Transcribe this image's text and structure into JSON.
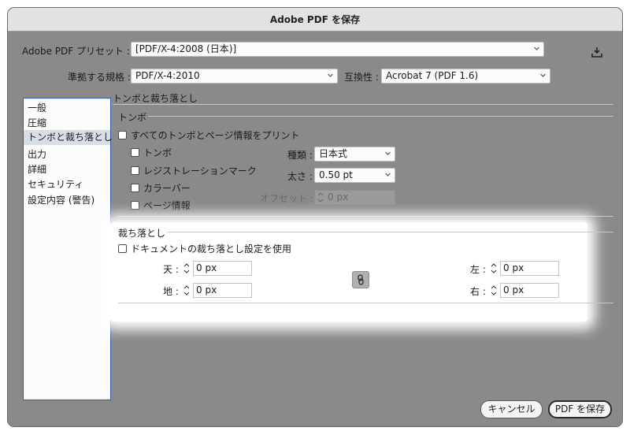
{
  "window": {
    "title": "Adobe PDF を保存"
  },
  "preset": {
    "label": "Adobe PDF プリセット :",
    "value": "[PDF/X-4:2008 (日本)]"
  },
  "standard": {
    "label": "準拠する規格 :",
    "value": "PDF/X-4:2010"
  },
  "compat": {
    "label": "互換性 :",
    "value": "Acrobat 7 (PDF 1.6)"
  },
  "sidebar": {
    "items": [
      {
        "label": "一般"
      },
      {
        "label": "圧縮"
      },
      {
        "label": "トンボと裁ち落とし"
      },
      {
        "label": "出力"
      },
      {
        "label": "詳細"
      },
      {
        "label": "セキュリティ"
      },
      {
        "label": "設定内容 (警告)"
      }
    ],
    "selected_index": 2
  },
  "section": {
    "title": "トンボと裁ち落とし"
  },
  "marks": {
    "group_title": "トンボ",
    "all_marks": "すべてのトンボとページ情報をプリント",
    "trim_marks": "トンボ",
    "registration_marks": "レジストレーションマーク",
    "color_bars": "カラーバー",
    "page_info": "ページ情報",
    "type_label": "種類 :",
    "type_value": "日本式",
    "weight_label": "太さ :",
    "weight_value": "0.50 pt",
    "offset_label": "オフセット :",
    "offset_value": "0 px"
  },
  "bleed": {
    "group_title": "裁ち落とし",
    "use_document": "ドキュメントの裁ち落とし設定を使用",
    "top_label": "天 :",
    "top_value": "0 px",
    "bottom_label": "地 :",
    "bottom_value": "0 px",
    "left_label": "左 :",
    "left_value": "0 px",
    "right_label": "右 :",
    "right_value": "0 px"
  },
  "buttons": {
    "cancel": "キャンセル",
    "save": "PDF を保存"
  },
  "icons": {
    "save_preset": "save-preset-icon",
    "link": "chain-link-icon",
    "stepper": "up-down-stepper-icon",
    "chevron": "chevron-down-icon"
  },
  "colors": {
    "sidebar_border": "#2e5aa8",
    "selected_bg": "#d8dde6",
    "overlay": "#8a8a8a"
  }
}
